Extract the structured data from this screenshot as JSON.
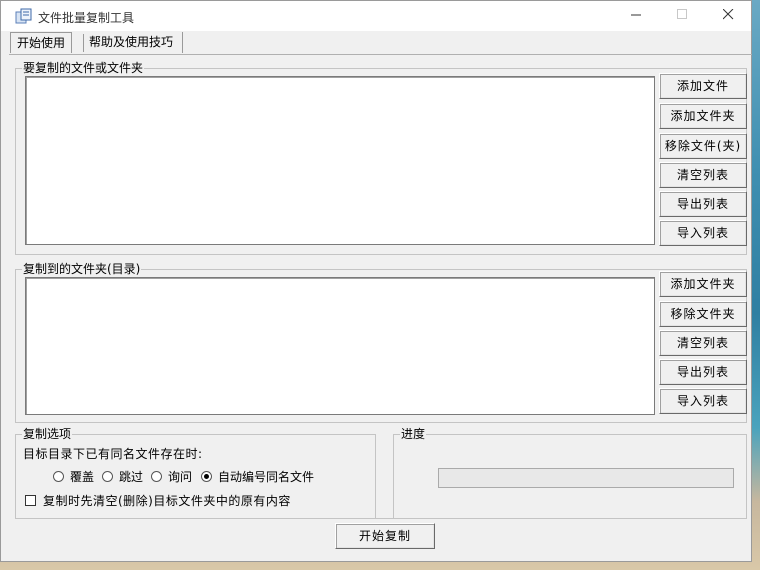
{
  "window": {
    "title": "文件批量复制工具"
  },
  "tabs": [
    {
      "label": "开始使用"
    },
    {
      "label": "帮助及使用技巧"
    }
  ],
  "source_group": {
    "label": "要复制的文件或文件夹",
    "buttons": [
      "添加文件",
      "添加文件夹",
      "移除文件(夹)",
      "清空列表",
      "导出列表",
      "导入列表"
    ]
  },
  "dest_group": {
    "label": "复制到的文件夹(目录)",
    "buttons": [
      "添加文件夹",
      "移除文件夹",
      "清空列表",
      "导出列表",
      "导入列表"
    ]
  },
  "options_group": {
    "label": "复制选项",
    "conflict_prompt": "目标目录下已有同名文件存在时:",
    "radios": [
      {
        "label": "覆盖",
        "checked": false
      },
      {
        "label": "跳过",
        "checked": false
      },
      {
        "label": "询问",
        "checked": false
      },
      {
        "label": "自动编号同名文件",
        "checked": true
      }
    ],
    "clear_checkbox": {
      "label": "复制时先清空(删除)目标文件夹中的原有内容",
      "checked": false
    }
  },
  "progress_group": {
    "label": "进度",
    "value": 0
  },
  "start_button": "开始复制"
}
